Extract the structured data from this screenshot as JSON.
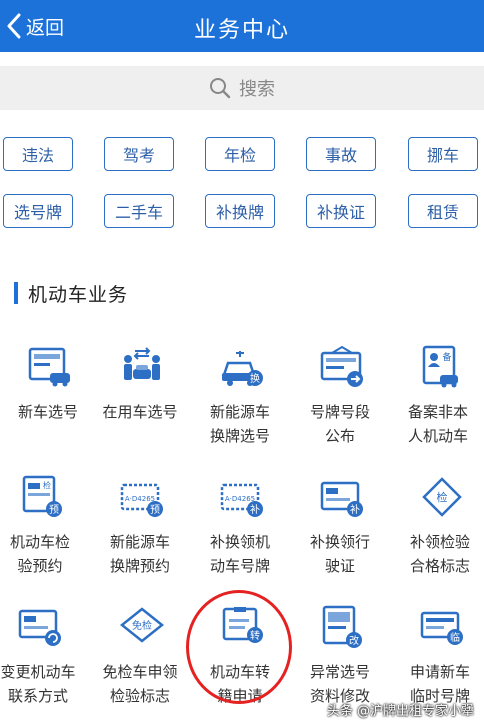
{
  "header": {
    "back_label": "返回",
    "title": "业务中心"
  },
  "search": {
    "placeholder": "搜索"
  },
  "tags_row1": [
    "违法",
    "驾考",
    "年检",
    "事故",
    "挪车"
  ],
  "tags_row2": [
    "选号牌",
    "二手车",
    "补换牌",
    "补换证",
    "租赁"
  ],
  "section": {
    "title": "机动车业务"
  },
  "services": [
    {
      "icon": "new-car-plate-icon",
      "line1": "新车选号",
      "line2": ""
    },
    {
      "icon": "used-car-plate-icon",
      "line1": "在用车选号",
      "line2": ""
    },
    {
      "icon": "ev-plate-change-icon",
      "line1": "新能源车",
      "line2": "换牌选号",
      "badge": "换"
    },
    {
      "icon": "plate-segment-icon",
      "line1": "号牌号段",
      "line2": "公布"
    },
    {
      "icon": "record-non-owner-icon",
      "line1": "备案非本",
      "line2": "人机动车",
      "badge": "备"
    },
    {
      "icon": "inspection-booking-icon",
      "line1": "机动车检",
      "line2": "验预约",
      "badge": "预",
      "tag": "检"
    },
    {
      "icon": "ev-plate-booking-icon",
      "line1": "新能源车",
      "line2": "换牌预约",
      "badge": "预",
      "plate": "A·D4265"
    },
    {
      "icon": "replace-plate-icon",
      "line1": "补换领机",
      "line2": "动车号牌",
      "badge": "补",
      "plate": "A·D4265"
    },
    {
      "icon": "replace-license-icon",
      "line1": "补换领行",
      "line2": "驶证",
      "badge": "补"
    },
    {
      "icon": "inspection-mark-icon",
      "line1": "补领检验",
      "line2": "合格标志",
      "badge": "检"
    },
    {
      "icon": "change-vehicle-contact-icon",
      "line1": "变更机动车",
      "line2": "联系方式"
    },
    {
      "icon": "exempt-inspection-mark-icon",
      "line1": "免检车申领",
      "line2": "检验标志",
      "badge": "免检"
    },
    {
      "icon": "vehicle-transfer-icon",
      "line1": "机动车转",
      "line2": "籍申请",
      "badge": "转"
    },
    {
      "icon": "plate-info-correction-icon",
      "line1": "异常选号",
      "line2": "资料修改",
      "badge": "改"
    },
    {
      "icon": "temporary-plate-icon",
      "line1": "申请新车",
      "line2": "临时号牌",
      "badge": "临"
    }
  ],
  "watermark": "头条 @沪牌出租专家小犟",
  "colors": {
    "primary": "#1c72d8",
    "tag_border": "#2d6fc4",
    "highlight": "#e52222"
  }
}
